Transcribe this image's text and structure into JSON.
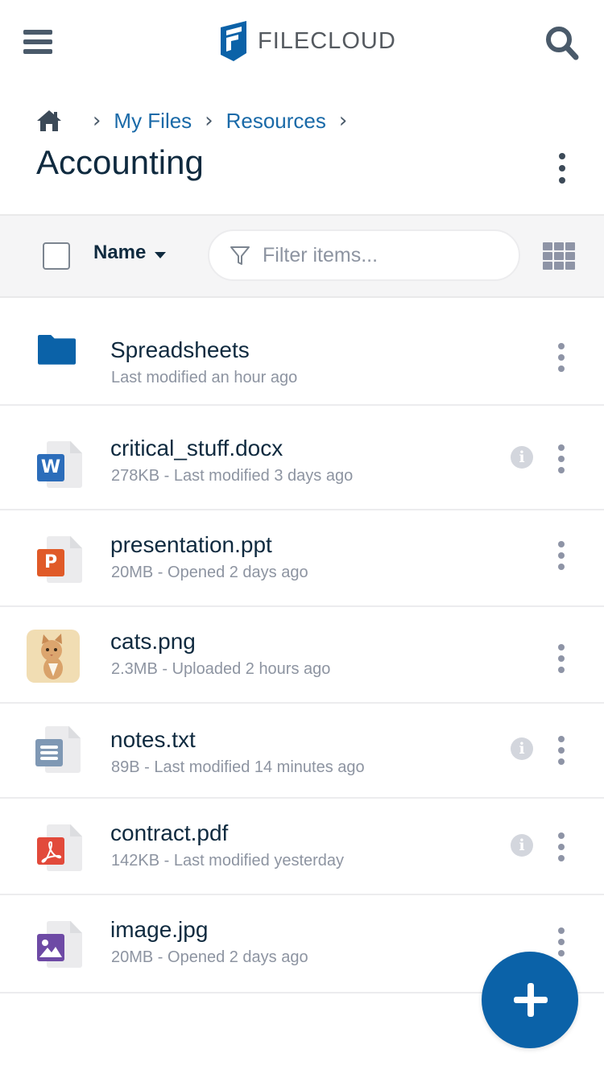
{
  "header": {
    "brand": "FILECLOUD",
    "menu_icon": "hamburger-menu-icon",
    "search_icon": "search-icon",
    "brand_color": "#0b62a8"
  },
  "breadcrumb": {
    "home_icon": "home-icon",
    "items": [
      "My Files",
      "Resources"
    ],
    "separator": "›"
  },
  "page": {
    "title": "Accounting"
  },
  "toolbar": {
    "sort_label": "Name",
    "filter_placeholder": "Filter items...",
    "filter_value": "",
    "view_toggle_icon": "grid-view-icon"
  },
  "items": [
    {
      "name": "Spreadsheets",
      "meta": "Last modified an hour ago",
      "type": "folder",
      "icon": "folder-icon",
      "has_info": false
    },
    {
      "name": "critical_stuff.docx",
      "meta": "278KB - Last modified 3 days ago",
      "type": "word",
      "icon": "word-document-icon",
      "badge": "W",
      "badge_color": "#2c6dba",
      "has_info": true
    },
    {
      "name": "presentation.ppt",
      "meta": "20MB - Opened 2 days ago",
      "type": "powerpoint",
      "icon": "powerpoint-icon",
      "badge": "P",
      "badge_color": "#e05a28",
      "has_info": false
    },
    {
      "name": "cats.png",
      "meta": "2.3MB - Uploaded 2 hours ago",
      "type": "image-thumbnail",
      "icon": "cat-thumbnail",
      "has_info": false
    },
    {
      "name": "notes.txt",
      "meta": "89B - Last modified 14 minutes ago",
      "type": "text",
      "icon": "text-document-icon",
      "badge_color": "#7f98b4",
      "has_info": true
    },
    {
      "name": "contract.pdf",
      "meta": "142KB - Last modified yesterday",
      "type": "pdf",
      "icon": "pdf-icon",
      "badge_color": "#e24a3b",
      "has_info": true
    },
    {
      "name": "image.jpg",
      "meta": "20MB - Opened 2 days ago",
      "type": "image",
      "icon": "image-file-icon",
      "badge_color": "#6e4aa5",
      "has_info": false
    }
  ],
  "fab": {
    "icon": "plus-icon"
  }
}
